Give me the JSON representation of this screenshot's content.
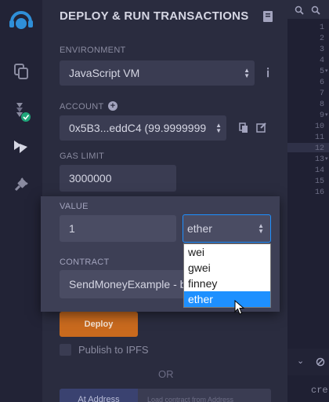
{
  "panel": {
    "title": "DEPLOY & RUN TRANSACTIONS",
    "environment": {
      "label": "ENVIRONMENT",
      "value": "JavaScript VM"
    },
    "account": {
      "label": "ACCOUNT",
      "value": "0x5B3...eddC4 (99.9999999"
    },
    "gas_limit": {
      "label": "GAS LIMIT",
      "value": "3000000"
    },
    "value": {
      "label": "VALUE",
      "amount": "1",
      "unit": "ether"
    },
    "contract": {
      "label": "CONTRACT",
      "value": "SendMoneyExample - b"
    },
    "deploy_label": "Deploy",
    "publish_label": "Publish to IPFS",
    "or_label": "OR",
    "at_address_label": "At Address",
    "load_contract_placeholder": "Load contract from Address"
  },
  "unit_dropdown": {
    "options": [
      "wei",
      "gwei",
      "finney",
      "ether"
    ],
    "selected": "ether"
  },
  "editor": {
    "line_numbers": [
      "1",
      "2",
      "3",
      "4",
      "5",
      "6",
      "7",
      "8",
      "9",
      "10",
      "11",
      "12",
      "13",
      "14",
      "15",
      "16"
    ],
    "snippet": "cre"
  },
  "colors": {
    "deploy_button": "#c96a1e",
    "selected_option": "#1e90ff",
    "status_check": "#1fa67a"
  }
}
